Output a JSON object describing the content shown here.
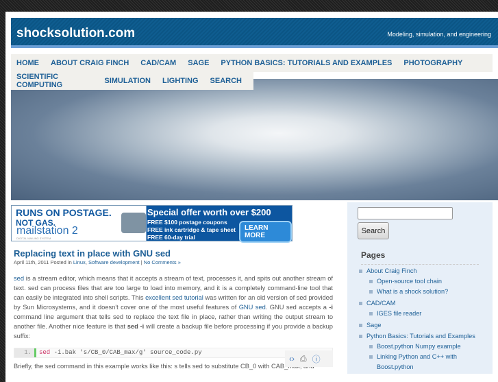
{
  "header": {
    "title": "shocksolution.com",
    "tagline": "Modeling, simulation, and engineering"
  },
  "nav": {
    "row1": [
      "HOME",
      "ABOUT CRAIG FINCH",
      "CAD/CAM",
      "SAGE",
      "PYTHON BASICS: TUTORIALS AND EXAMPLES",
      "PHOTOGRAPHY"
    ],
    "row2": [
      "SCIENTIFIC COMPUTING",
      "SIMULATION",
      "LIGHTING",
      "SEARCH"
    ]
  },
  "ad": {
    "l1": "RUNS ON POSTAGE.",
    "l2": "NOT GAS.",
    "brand": "mailstation 2",
    "brand_sub": "DIGITAL MAILING SYSTEM",
    "headline": "Special offer worth over $200",
    "f1": "FREE $100 postage coupons",
    "f2": "FREE ink cartridge & tape sheet",
    "f3": "FREE 60-day trial",
    "cta": "LEARN MORE"
  },
  "post": {
    "title": "Replacing text in place with GNU sed",
    "date": "April 11th, 2011 Posted in ",
    "cat1": "Linux",
    "sep": ", ",
    "cat2": "Software development",
    "bar": " | ",
    "comments": "No Comments »",
    "p1": "sed",
    "p2": " is a stream editor, which means that it accepts a stream of text, processes it, and spits out another stream of text.  sed can process files that are too large to load into memory, and it is a completely command-line tool that can easily be integrated into shell scripts.  This ",
    "p3": "excellent sed tutorial",
    "p4": " was written for an old version of sed provided by Sun Microsystems, and it doesn't cover one of the most useful features of ",
    "p5": "GNU sed",
    "p6": ".  GNU sed accepts a ",
    "p7": "-i",
    "p8": " command line argument that tells sed to replace the text file in place, rather than writing the output stream to another file.  Another nice feature is that ",
    "p9": "sed -i",
    "p10": " will create a backup file before processing if you provide a backup suffix:",
    "code_ln": "1.",
    "code_kw": "sed",
    "code_rest": " -i.bak 's/CB_0/CAB_max/g' source_code.py",
    "p_after": "Briefly, the sed command in this example works like this: s tells sed to substitute CB_0 with CAB_max, and"
  },
  "sidebar": {
    "search_button": "Search",
    "pages_heading": "Pages",
    "pages": [
      {
        "label": "About Craig Finch",
        "level": 0
      },
      {
        "label": "Open-source tool chain",
        "level": 1
      },
      {
        "label": "What is a shock solution?",
        "level": 1
      },
      {
        "label": "CAD/CAM",
        "level": 0
      },
      {
        "label": "IGES file reader",
        "level": 1
      },
      {
        "label": "Sage",
        "level": 0
      },
      {
        "label": "Python Basics: Tutorials and Examples",
        "level": 0
      },
      {
        "label": "Boost.python Numpy example",
        "level": 1
      },
      {
        "label": "Linking Python and C++ with Boost.python",
        "level": 1
      }
    ]
  }
}
